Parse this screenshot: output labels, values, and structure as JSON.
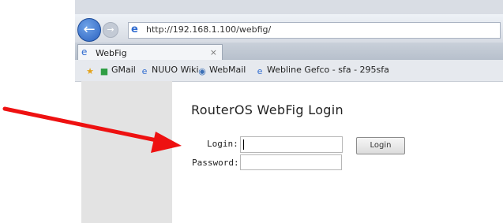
{
  "browser": {
    "url": "http://192.168.1.100/webfig/",
    "tab_title": "WebFig",
    "tab_close": "×",
    "back_glyph": "←",
    "forward_glyph": "→",
    "ie_glyph": "e",
    "favorites": [
      {
        "label": "",
        "icon": "favorites-star-icon",
        "glyph": "★",
        "color": "#e3a21a"
      },
      {
        "label": "GMail",
        "icon": "gmail-icon",
        "glyph": "■",
        "color": "#2f9e44"
      },
      {
        "label": "NUUO Wiki",
        "icon": "ie-page-icon",
        "glyph": "e",
        "color": "#2f6bd0"
      },
      {
        "label": "WebMail",
        "icon": "webmail-icon",
        "glyph": "◉",
        "color": "#3b6fb6"
      },
      {
        "label": "Webline Gefco - sfa - 295sfa",
        "icon": "page-icon",
        "glyph": "e",
        "color": "#2f6bd0"
      }
    ]
  },
  "page": {
    "title": "RouterOS WebFig Login",
    "login_label": "Login:",
    "password_label": "Password:",
    "login_value": "",
    "password_value": "",
    "login_button": "Login"
  },
  "annotation": {
    "arrow_color": "#ee1111"
  }
}
